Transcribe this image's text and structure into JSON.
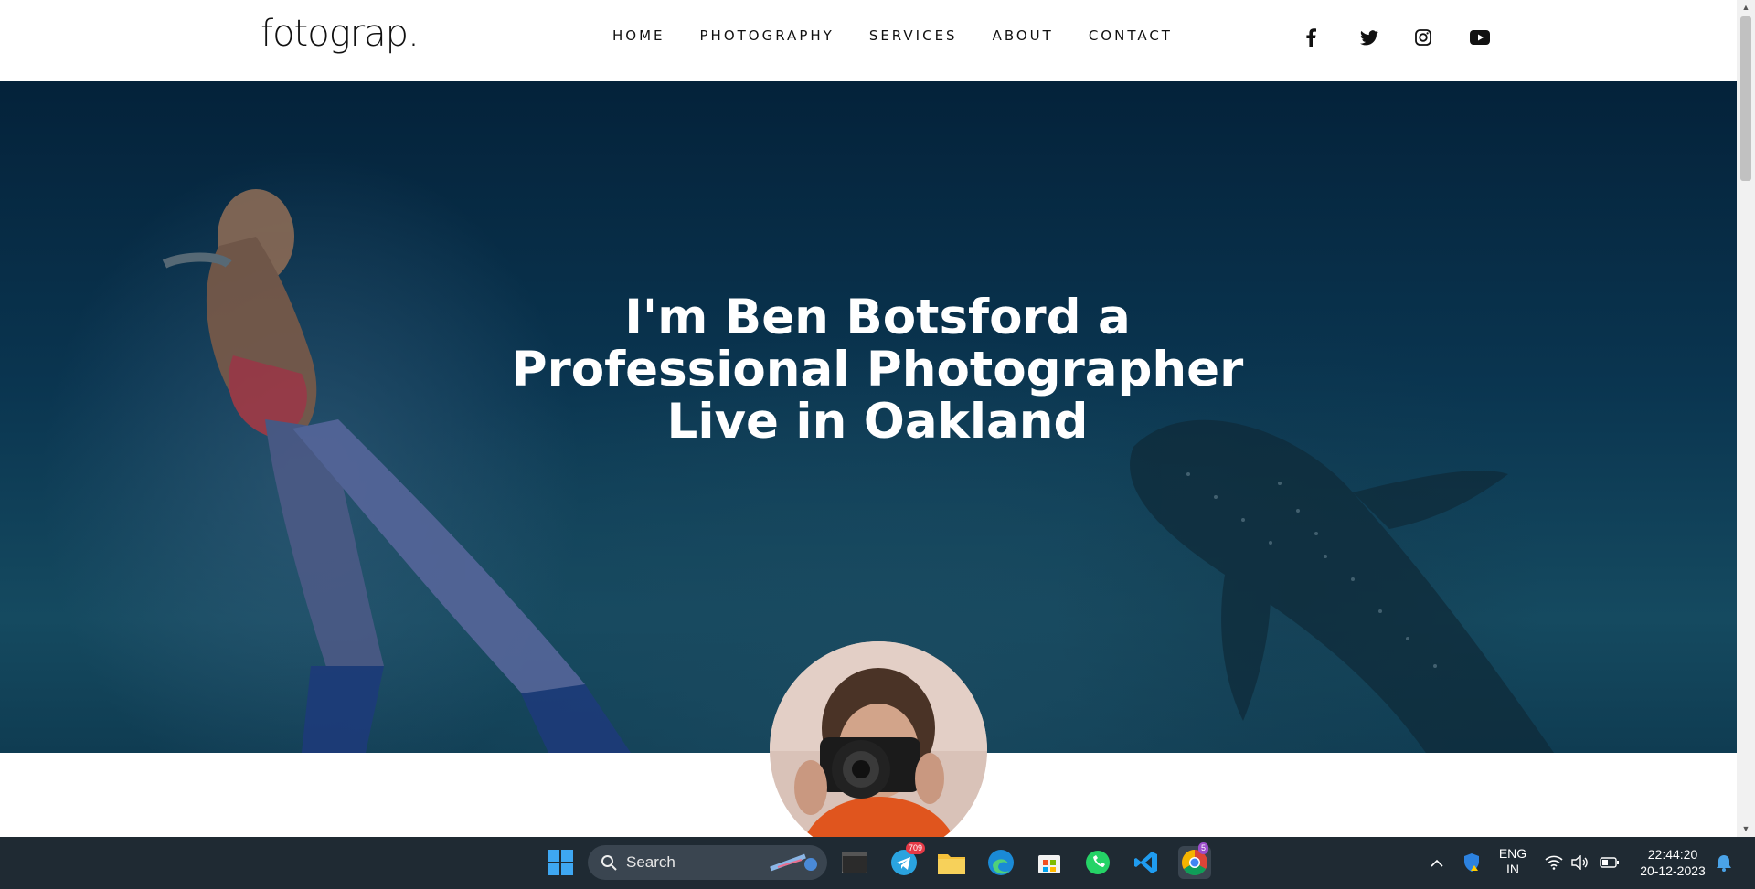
{
  "header": {
    "logo": "fotograp.",
    "nav": [
      "HOME",
      "PHOTOGRAPHY",
      "SERVICES",
      "ABOUT",
      "CONTACT"
    ],
    "social_icons": [
      "facebook-icon",
      "twitter-icon",
      "instagram-icon",
      "youtube-icon"
    ]
  },
  "hero": {
    "title_line1": "I'm Ben Botsford a",
    "title_line2": "Professional Photographer",
    "title_line3": "Live in Oakland"
  },
  "taskbar": {
    "search_label": "Search",
    "telegram_badge": "709",
    "chrome_badge": "5",
    "language_line1": "ENG",
    "language_line2": "IN",
    "time": "22:44:20",
    "date": "20-12-2023",
    "icons": [
      "windows-start-icon",
      "search-icon",
      "terminal-icon",
      "telegram-icon",
      "file-explorer-icon",
      "edge-icon",
      "store-icon",
      "whatsapp-icon",
      "vscode-icon",
      "chrome-icon"
    ],
    "tray_icons": [
      "chevron-up-icon",
      "security-icon",
      "wifi-icon",
      "volume-icon",
      "battery-icon",
      "notification-icon"
    ]
  },
  "colors": {
    "header_bg": "#ffffff",
    "hero_dark": "#04223a",
    "taskbar_bg": "#1f2a33"
  }
}
